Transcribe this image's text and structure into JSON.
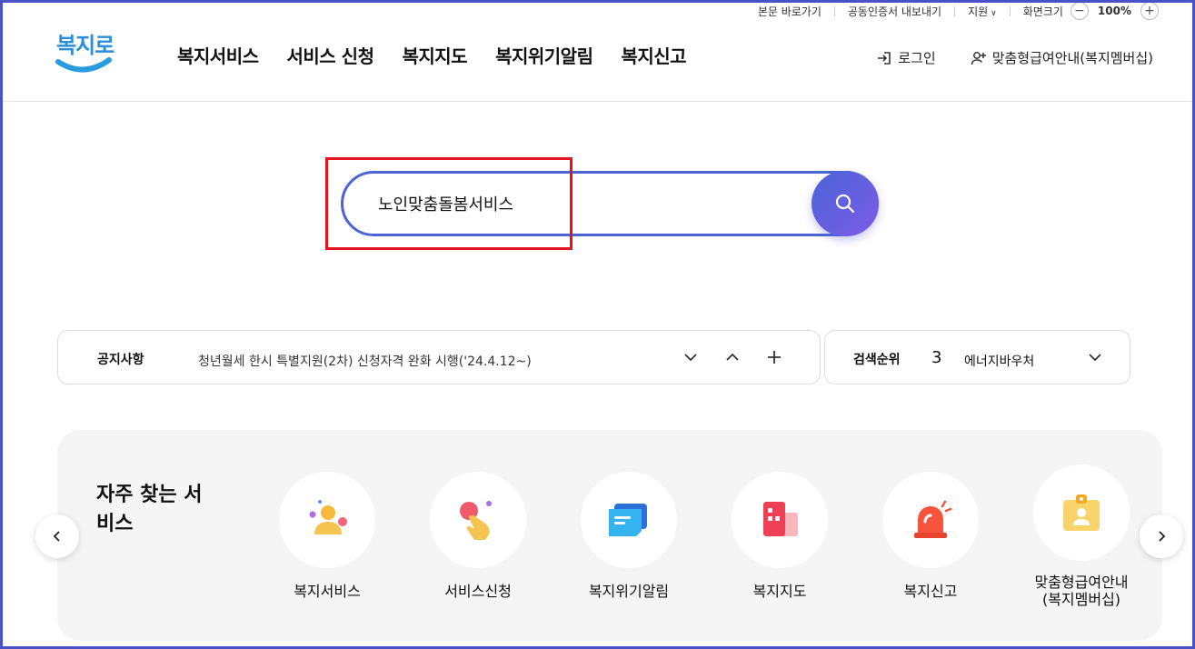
{
  "utility": {
    "skip": "본문 바로가기",
    "cert": "공동인증서 내보내기",
    "support": "지원",
    "zoom_label": "화면크기",
    "zoom_minus": "−",
    "zoom_value": "100%",
    "zoom_plus": "+"
  },
  "logo": {
    "text": "복지로"
  },
  "gnb": [
    "복지서비스",
    "서비스 신청",
    "복지지도",
    "복지위기알림",
    "복지신고"
  ],
  "header_right": {
    "login": "로그인",
    "membership": "맞춤형급여안내(복지멤버십)"
  },
  "search": {
    "value": "노인맞춤돌봄서비스"
  },
  "notice": {
    "label": "공지사항",
    "text": "청년월세 한시 특별지원(2차) 신청자격 완화 시행('24.4.12~)"
  },
  "ranking": {
    "label": "검색순위",
    "rank": "3",
    "keyword": "에너지바우처"
  },
  "frequent": {
    "title": "자주 찾는 서비스",
    "items": [
      {
        "name": "복지서비스",
        "icon": "person-icon"
      },
      {
        "name": "서비스신청",
        "icon": "hand-tap-icon"
      },
      {
        "name": "복지위기알림",
        "icon": "message-icon"
      },
      {
        "name": "복지지도",
        "icon": "map-icon"
      },
      {
        "name": "복지신고",
        "icon": "siren-icon"
      },
      {
        "name": "맞춤형급여안내\n(복지멤버십)",
        "icon": "id-card-icon"
      }
    ]
  },
  "colors": {
    "brand": "#4a64d8",
    "accent": "#7e5be6",
    "highlight": "#e3141f",
    "logo": "#2a8ed8"
  }
}
